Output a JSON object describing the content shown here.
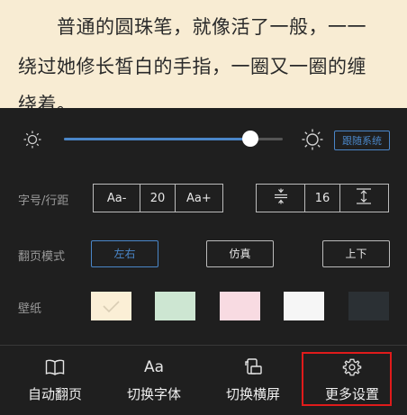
{
  "reader": {
    "lines": [
      "　　普通的圆珠笔，就像活了一般，一一",
      "绕过她修长皙白的手指，一圈又一圈的缠",
      "绕着。"
    ]
  },
  "brightness": {
    "level": 0.85,
    "follow_system_label": "跟随系统"
  },
  "font_size": {
    "label": "字号/行距",
    "decrease_label": "Aa-",
    "value": "20",
    "increase_label": "Aa+"
  },
  "line_spacing": {
    "value": "16"
  },
  "page_mode": {
    "label": "翻页模式",
    "options": [
      {
        "label": "左右",
        "active": true
      },
      {
        "label": "仿真",
        "active": false
      },
      {
        "label": "上下",
        "active": false
      }
    ]
  },
  "wallpaper": {
    "label": "壁纸",
    "colors": [
      "#fbefd6",
      "#cde6d2",
      "#f8dbe2",
      "#f6f6f6",
      "#2b3034"
    ],
    "selected_index": 0
  },
  "bottom_bar": {
    "items": [
      {
        "label": "自动翻页",
        "icon": "book-open-icon"
      },
      {
        "label": "切换字体",
        "icon": "font-aa-icon"
      },
      {
        "label": "切换横屏",
        "icon": "rotate-screen-icon"
      },
      {
        "label": "更多设置",
        "icon": "gear-icon"
      }
    ]
  },
  "colors": {
    "accent": "#4a86c8",
    "panel_bg": "#1f1f1f",
    "reader_bg": "#f8ecd3",
    "highlight": "#e01b1b"
  }
}
